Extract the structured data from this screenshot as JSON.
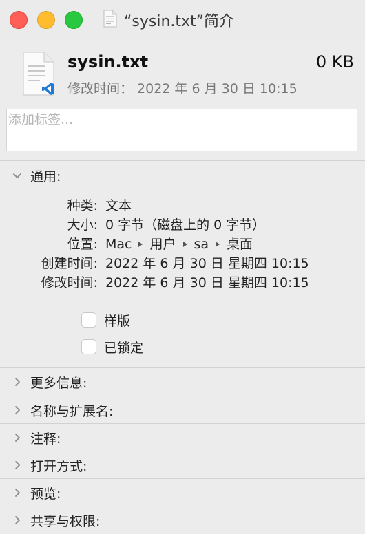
{
  "window": {
    "title": "“sysin.txt”简介"
  },
  "header": {
    "file_name": "sysin.txt",
    "file_size": "0 KB",
    "modified": "修改时间： 2022 年 6 月 30 日 10:15"
  },
  "tags": {
    "placeholder": "添加标签..."
  },
  "general": {
    "title": "通用:",
    "rows": [
      {
        "key": "种类:",
        "value": "文本"
      },
      {
        "key": "大小:",
        "value": "0 字节（磁盘上的 0 字节）"
      },
      {
        "key": "位置:",
        "path": [
          "Mac",
          "用户",
          "sa",
          "桌面"
        ]
      },
      {
        "key": "创建时间:",
        "value": "2022 年 6 月 30 日 星期四 10:15"
      },
      {
        "key": "修改时间:",
        "value": "2022 年 6 月 30 日 星期四 10:15"
      }
    ],
    "checkboxes": [
      {
        "label": "样版",
        "checked": false
      },
      {
        "label": "已锁定",
        "checked": false
      }
    ]
  },
  "sections": [
    {
      "label": "更多信息:"
    },
    {
      "label": "名称与扩展名:"
    },
    {
      "label": "注释:"
    },
    {
      "label": "打开方式:"
    },
    {
      "label": "预览:"
    },
    {
      "label": "共享与权限:"
    }
  ],
  "colors": {
    "close": "#fe5f57",
    "minimize": "#febc2e",
    "zoom": "#28c840",
    "vscode_badge": "#1f7ad6"
  },
  "icons": {
    "title_icon": "text-document-icon",
    "file_icon": "vscode-text-file-icon"
  }
}
